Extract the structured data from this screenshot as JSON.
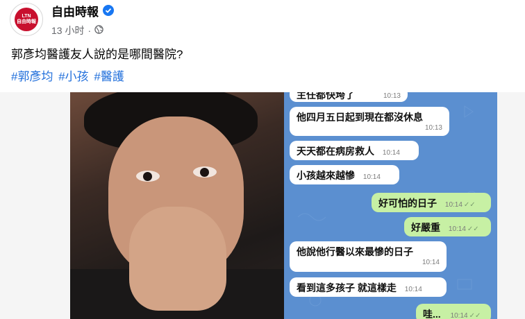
{
  "post": {
    "page_name": "自由時報",
    "time_ago": "13 小时",
    "dot": "·",
    "avatar_text": [
      "LTN",
      "自由時報"
    ],
    "caption": "郭彥均醫護友人說的是哪間醫院?",
    "hashtags": [
      "#郭彥均",
      "#小孩",
      "#醫護"
    ]
  },
  "chat": {
    "messages": [
      {
        "text": "主任都快垮了",
        "time": "10:13",
        "outgoing": false
      },
      {
        "text": "他四月五日起到現在都沒休息",
        "time": "10:13",
        "outgoing": false
      },
      {
        "text": "天天都在病房救人",
        "time": "10:14",
        "outgoing": false
      },
      {
        "text": "小孩越來越慘",
        "time": "10:14",
        "outgoing": false
      },
      {
        "text": "好可怕的日子",
        "time": "10:14",
        "outgoing": true
      },
      {
        "text": "好嚴重",
        "time": "10:14",
        "outgoing": true
      },
      {
        "text": "他說他行醫以來最慘的日子",
        "time": "10:14",
        "outgoing": false
      },
      {
        "text": "看到這多孩子 就這樣走",
        "time": "10:14",
        "outgoing": false
      },
      {
        "text": "哇...",
        "time": "10:14",
        "outgoing": true
      }
    ]
  },
  "colors": {
    "verified_badge": "#1877f2",
    "hashtag": "#216fdb",
    "chat_background": "#5b8fd0",
    "outgoing_bubble": "#c7f0a4"
  }
}
